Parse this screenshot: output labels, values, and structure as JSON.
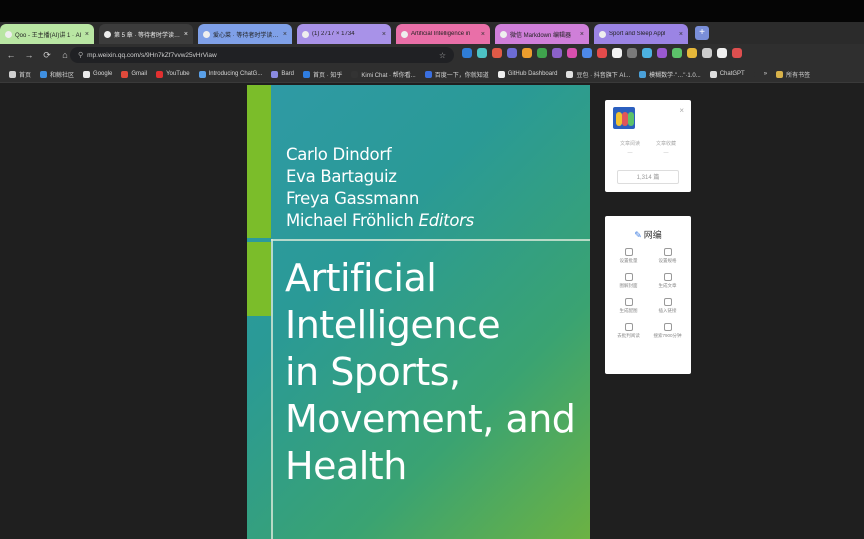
{
  "tabs": [
    {
      "title": "Qoo - 王主播(AI)讲 1 · AI",
      "bg": "#b9e6a3",
      "dark": false
    },
    {
      "title": "第 5 章 · 等待者时学读 1 (1",
      "bg": "#3c3c3c",
      "dark": true
    },
    {
      "title": "爱心菜 · 等待者时学读 1 (1",
      "bg": "#7fa0e8",
      "dark": false
    },
    {
      "title": "(1) 2717 × 1734",
      "bg": "#a892e8",
      "dark": false
    },
    {
      "title": "Artificial Intelligence in",
      "bg": "#e96fa8",
      "dark": false
    },
    {
      "title": "微信 Markdown 编辑器",
      "bg": "#cf7fd9",
      "dark": false
    },
    {
      "title": "Sport and Sleep Appl",
      "bg": "#9b84e4",
      "dark": false
    }
  ],
  "new_tab_label": "+",
  "nav": {
    "back": "←",
    "forward": "→",
    "reload": "⟳",
    "home": "⌂"
  },
  "omnibox": {
    "url": "mp.weixin.qq.com/s/9Hn7kZf7vvw25vHrViaw",
    "star": "☆",
    "lock": "⚲"
  },
  "extension_colors": [
    "#2f7dd6",
    "#4cc2c4",
    "#e05a47",
    "#6c6cd6",
    "#ec9d2d",
    "#3fa34d",
    "#8b61c9",
    "#d94fae",
    "#4d88e8",
    "#e44b4b",
    "#f2f2f2",
    "#7a7a7a",
    "#4cb1e0",
    "#9a59d1",
    "#5cc26a",
    "#e6b83a",
    "#cccccc",
    "#f0f0f0",
    "#de4f4f"
  ],
  "bookmarks": [
    {
      "label": "首页",
      "color": "#d0d0d0"
    },
    {
      "label": "和鲸社区",
      "color": "#3f8fe0"
    },
    {
      "label": "Google",
      "color": "#eaeaea"
    },
    {
      "label": "Gmail",
      "color": "#e04a3b"
    },
    {
      "label": "YouTube",
      "color": "#e23030"
    },
    {
      "label": "Introducing ChatG...",
      "color": "#5aa0e8"
    },
    {
      "label": "Bard",
      "color": "#8a8ae0"
    },
    {
      "label": "首页 · 知乎",
      "color": "#2f7de0"
    },
    {
      "label": "Kimi Chat · 帮你看...",
      "color": "#333333"
    },
    {
      "label": "百度一下，你就知道",
      "color": "#3a6fe0"
    },
    {
      "label": "GitHub Dashboard",
      "color": "#eeeeee"
    },
    {
      "label": "豆包 · 抖音旗下 AI...",
      "color": "#e0e0e0"
    },
    {
      "label": "模糊数学·\"…\"·1.0...",
      "color": "#4aa0d8"
    },
    {
      "label": "ChatGPT",
      "color": "#dddddd"
    },
    {
      "label": "»",
      "color": "#2f2f2f"
    },
    {
      "label": "所有书签",
      "color": "#d8b24a"
    }
  ],
  "book": {
    "authors": [
      "Carlo Dindorf",
      "Eva Bartaguiz",
      "Freya Gassmann",
      "Michael Fröhlich"
    ],
    "editors_label": "Editors",
    "title_lines": [
      "Artificial",
      "Intelligence",
      "in Sports,",
      "Movement, and",
      "Health"
    ]
  },
  "profile_card": {
    "stats": [
      {
        "label": "文章阅读",
        "value": "—"
      },
      {
        "label": "文章收藏",
        "value": "—"
      }
    ],
    "button": "1,314 篇",
    "close": "×"
  },
  "tools_card": {
    "title": "网编",
    "items": [
      "设置批量",
      "设置规格",
      "图解封面",
      "生成文章",
      "生成配图",
      "插入链接",
      "去批判阅读",
      "搜索7900分钟"
    ]
  }
}
